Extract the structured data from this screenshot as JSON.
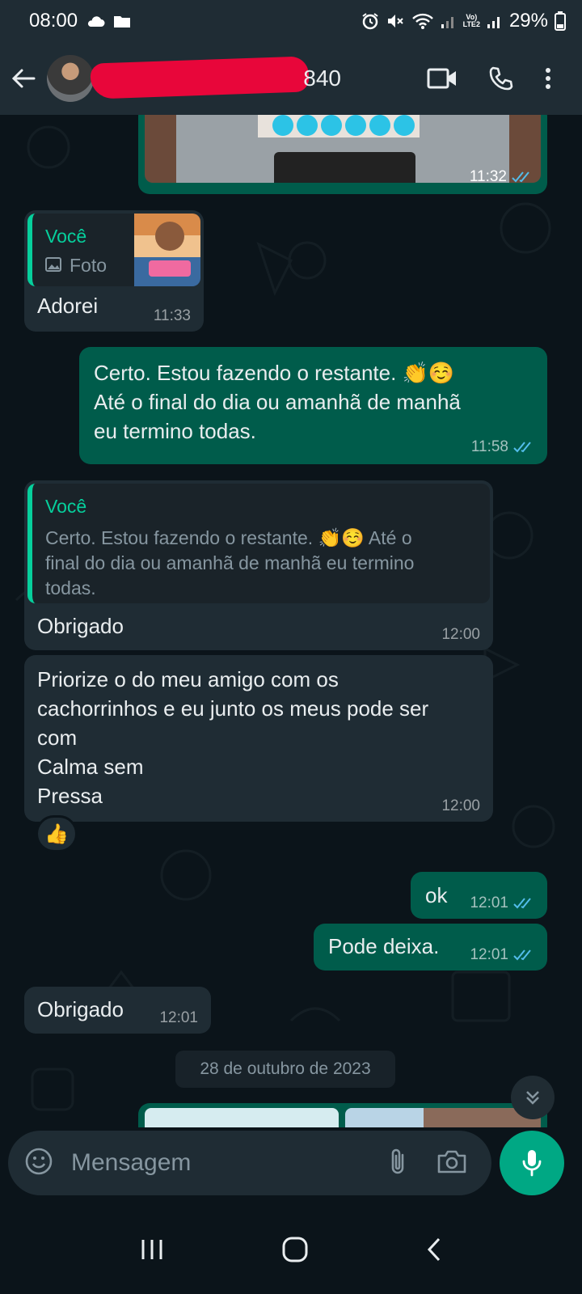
{
  "status_bar": {
    "time": "08:00",
    "network_label": "LTE2",
    "volte_label": "Vo)",
    "battery": "29%"
  },
  "header": {
    "contact_name_visible": "840",
    "icons": [
      "back-arrow-icon",
      "avatar",
      "video-call-icon",
      "phone-icon",
      "more-options-icon"
    ]
  },
  "messages": [
    {
      "type": "image",
      "direction": "out",
      "time": "11:32",
      "ticks": "read"
    },
    {
      "type": "reply",
      "direction": "in",
      "quote_author": "Você",
      "quote_text": "Foto",
      "quote_media": "photo",
      "text": "Adorei",
      "time": "11:33"
    },
    {
      "type": "text",
      "direction": "out",
      "lines": [
        "Certo. Estou fazendo o restante. 👏☺️",
        "Até o final do dia ou amanhã de manhã",
        "eu termino todas."
      ],
      "time": "11:58",
      "ticks": "read"
    },
    {
      "type": "reply",
      "direction": "in",
      "quote_author": "Você",
      "quote_lines": [
        "Certo. Estou fazendo o restante. 👏☺️ Até o",
        "final do dia ou amanhã de manhã eu termino",
        "todas."
      ],
      "text": "Obrigado",
      "time": "12:00"
    },
    {
      "type": "text",
      "direction": "in",
      "lines": [
        "Priorize o do meu amigo com os",
        "cachorrinhos e eu junto os meus pode ser",
        "com",
        "Calma sem",
        "Pressa"
      ],
      "time": "12:00",
      "reaction": "👍"
    },
    {
      "type": "text",
      "direction": "out",
      "text": "ok",
      "time": "12:01",
      "ticks": "read"
    },
    {
      "type": "text",
      "direction": "out",
      "text": "Pode deixa.",
      "time": "12:01",
      "ticks": "read"
    },
    {
      "type": "text",
      "direction": "in",
      "text": "Obrigado",
      "time": "12:01"
    }
  ],
  "date_separator": "28 de outubro de 2023",
  "composer": {
    "placeholder": "Mensagem",
    "icons": [
      "emoji-icon",
      "attach-icon",
      "camera-icon",
      "mic-icon"
    ]
  },
  "colors": {
    "header_bg": "#1f2c34",
    "chat_bg": "#0b141a",
    "incoming_bubble": "#1f2c34",
    "outgoing_bubble": "#005c4b",
    "accent": "#00a884",
    "quote_author": "#06cf9c",
    "read_ticks": "#53bdeb",
    "redaction": "#e8063a"
  }
}
